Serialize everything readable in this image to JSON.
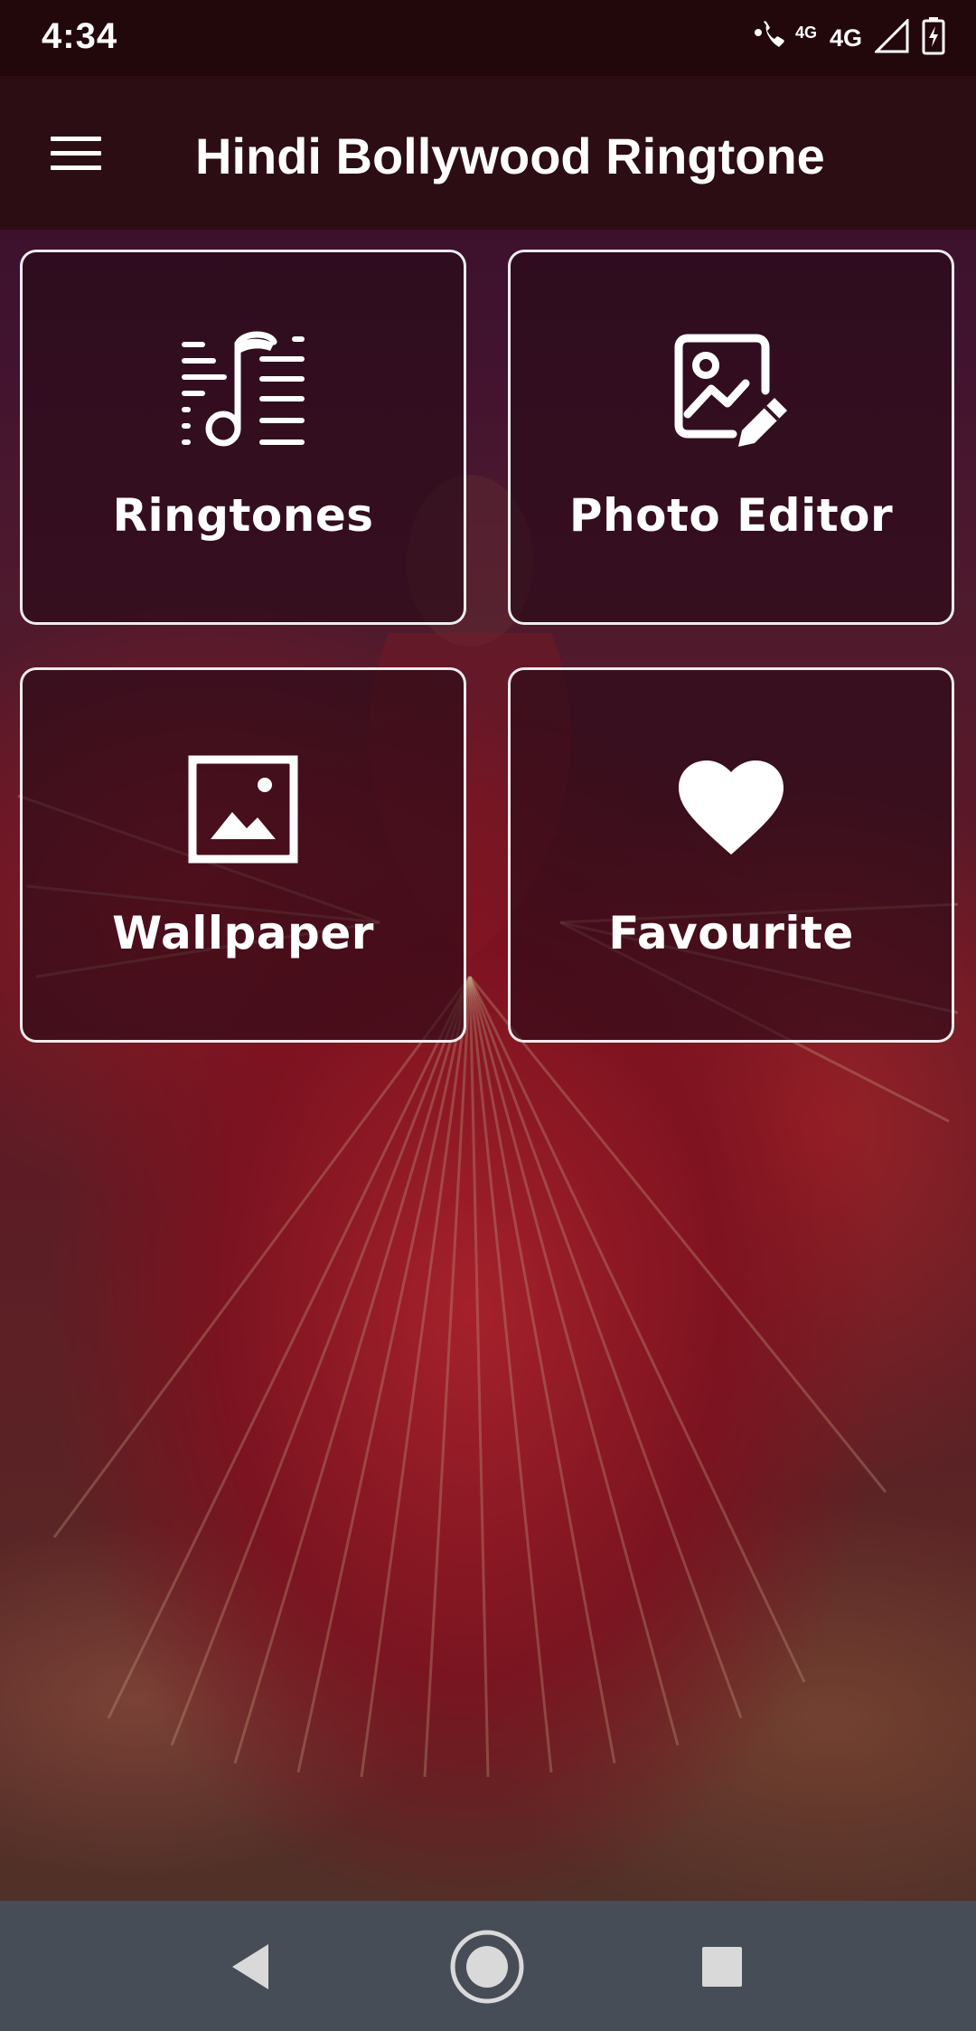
{
  "status_bar": {
    "time": "4:34",
    "call_network": "4G",
    "network": "4G"
  },
  "app_bar": {
    "title": "Hindi Bollywood Ringtone",
    "menu_icon": "hamburger-menu-icon"
  },
  "tiles": [
    {
      "label": "Ringtones",
      "icon": "music-list-icon"
    },
    {
      "label": "Photo Editor",
      "icon": "image-edit-icon"
    },
    {
      "label": "Wallpaper",
      "icon": "wallpaper-icon"
    },
    {
      "label": "Favourite",
      "icon": "heart-icon"
    }
  ],
  "nav_bar": {
    "back_icon": "back-triangle-icon",
    "home_icon": "home-circle-icon",
    "recent_icon": "recents-square-icon"
  },
  "colors": {
    "status_bar": "#22070b",
    "app_bar": "#2c0d14",
    "tile_border": "#ffffff",
    "nav_bar": "#474d56"
  }
}
